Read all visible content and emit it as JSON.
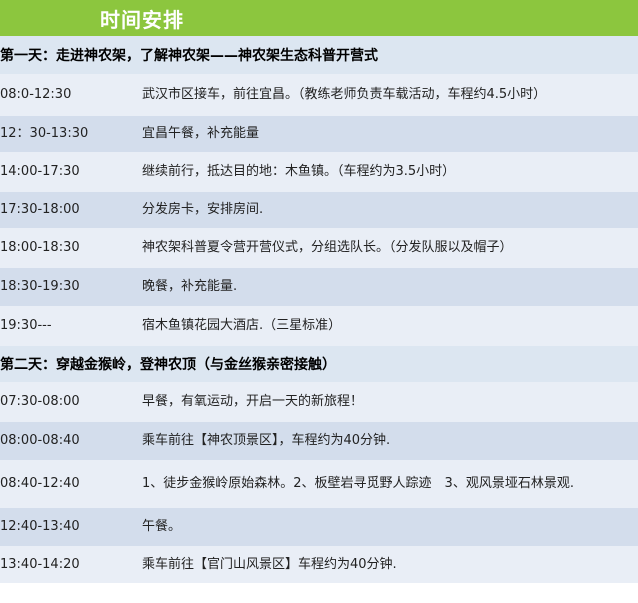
{
  "header": {
    "time": "时间",
    "plan": "安排"
  },
  "day1": {
    "title": "第一天：走进神农架，了解神农架——神农架生态科普开营式",
    "rows": [
      {
        "time": "08:0-12:30",
        "plan": "武汉市区接车，前往宜昌。（教练老师负责车载活动，车程约4.5小时）"
      },
      {
        "time": "12：30-13:30",
        "plan": "宜昌午餐，补充能量"
      },
      {
        "time": "14:00-17:30",
        "plan": "继续前行，抵达目的地：木鱼镇。（车程约为3.5小时）"
      },
      {
        "time": "17:30-18:00",
        "plan": "分发房卡，安排房间."
      },
      {
        "time": "18:00-18:30",
        "plan": "神农架科普夏令营开营仪式，分组选队长。（分发队服以及帽子）"
      },
      {
        "time": "18:30-19:30",
        "plan": "晚餐，补充能量."
      },
      {
        "time": "19:30---",
        "plan": "宿木鱼镇花园大酒店.（三星标准）"
      }
    ]
  },
  "day2": {
    "title": "第二天：穿越金猴岭，登神农顶（与金丝猴亲密接触）",
    "rows": [
      {
        "time": "07:30-08:00",
        "plan": "早餐，有氧运动，开启一天的新旅程！"
      },
      {
        "time": "08:00-08:40",
        "plan": "乘车前往【神农顶景区】，车程约为40分钟."
      },
      {
        "time": "08:40-12:40",
        "plan": "1、徒步金猴岭原始森林。2、板壁岩寻觅野人踪迹　3、观风景垭石林景观."
      },
      {
        "time": "12:40-13:40",
        "plan": "午餐。"
      },
      {
        "time": "13:40-14:20",
        "plan": "乘车前往【官门山风景区】车程约为40分钟."
      }
    ]
  }
}
